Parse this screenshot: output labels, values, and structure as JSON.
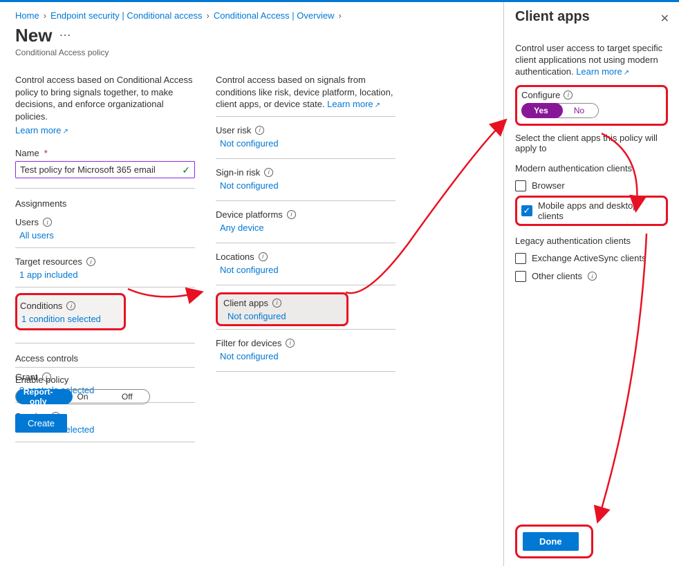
{
  "breadcrumbs": [
    "Home",
    "Endpoint security | Conditional access",
    "Conditional Access | Overview"
  ],
  "title": "New",
  "subtitle": "Conditional Access policy",
  "col1": {
    "intro": "Control access based on Conditional Access policy to bring signals together, to make decisions, and enforce organizational policies.",
    "learn_more": "Learn more",
    "name_label": "Name",
    "name_value": "Test policy for Microsoft 365 email",
    "assignments_head": "Assignments",
    "users_label": "Users",
    "users_value": "All users",
    "target_label": "Target resources",
    "target_value": "1 app included",
    "conditions_label": "Conditions",
    "conditions_value": "1 condition selected",
    "access_head": "Access controls",
    "grant_label": "Grant",
    "grant_value": "0 controls selected",
    "session_label": "Session",
    "session_value": "0 controls selected"
  },
  "col2": {
    "intro": "Control access based on signals from conditions like risk, device platform, location, client apps, or device state.",
    "learn_more": "Learn more",
    "items": [
      {
        "label": "User risk",
        "value": "Not configured"
      },
      {
        "label": "Sign-in risk",
        "value": "Not configured"
      },
      {
        "label": "Device platforms",
        "value": "Any device"
      },
      {
        "label": "Locations",
        "value": "Not configured"
      },
      {
        "label": "Client apps",
        "value": "Not configured"
      },
      {
        "label": "Filter for devices",
        "value": "Not configured"
      }
    ]
  },
  "footer": {
    "enable_label": "Enable policy",
    "options": [
      "Report-only",
      "On",
      "Off"
    ],
    "create_label": "Create"
  },
  "panel": {
    "title": "Client apps",
    "intro": "Control user access to target specific client applications not using modern authentication.",
    "learn_more": "Learn more",
    "configure_label": "Configure",
    "yes": "Yes",
    "no": "No",
    "select_text": "Select the client apps this policy will apply to",
    "modern_head": "Modern authentication clients",
    "browser_label": "Browser",
    "mobile_label": "Mobile apps and desktop clients",
    "legacy_head": "Legacy authentication clients",
    "eas_label": "Exchange ActiveSync clients",
    "other_label": "Other clients",
    "done_label": "Done"
  }
}
